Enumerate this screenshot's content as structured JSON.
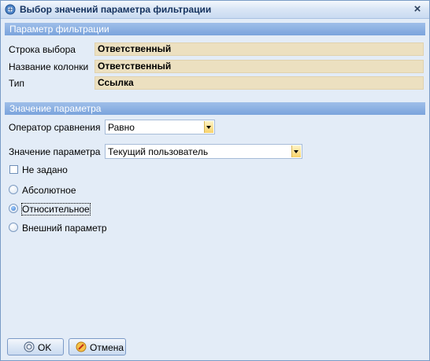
{
  "window": {
    "title": "Выбор значений параметра фильтрации",
    "close_symbol": "×"
  },
  "filter_section": {
    "header": "Параметр фильтрации",
    "rows": [
      {
        "label": "Строка выбора",
        "value": "Ответственный"
      },
      {
        "label": "Название колонки",
        "value": "Ответственный"
      },
      {
        "label": "Тип",
        "value": "Ссылка"
      }
    ]
  },
  "value_section": {
    "header": "Значение параметра",
    "operator_label": "Оператор сравнения",
    "operator_value": "Равно",
    "param_label": "Значение параметра",
    "param_value": "Текущий пользователь",
    "not_set_label": "Не задано",
    "not_set_checked": false,
    "radios": [
      {
        "label": "Абсолютное",
        "checked": false
      },
      {
        "label": "Относительное",
        "checked": true
      },
      {
        "label": "Внешний параметр",
        "checked": false
      }
    ]
  },
  "buttons": {
    "ok_label": "OK",
    "cancel_label": "Отмена"
  },
  "icons": {
    "title": "filter-dialog-icon",
    "ok": "ok-icon",
    "cancel": "cancel-icon"
  },
  "colors": {
    "section_header": "#7aa3dc",
    "readonly_field": "#ece0c0",
    "window_bg": "#e3ecf7"
  }
}
